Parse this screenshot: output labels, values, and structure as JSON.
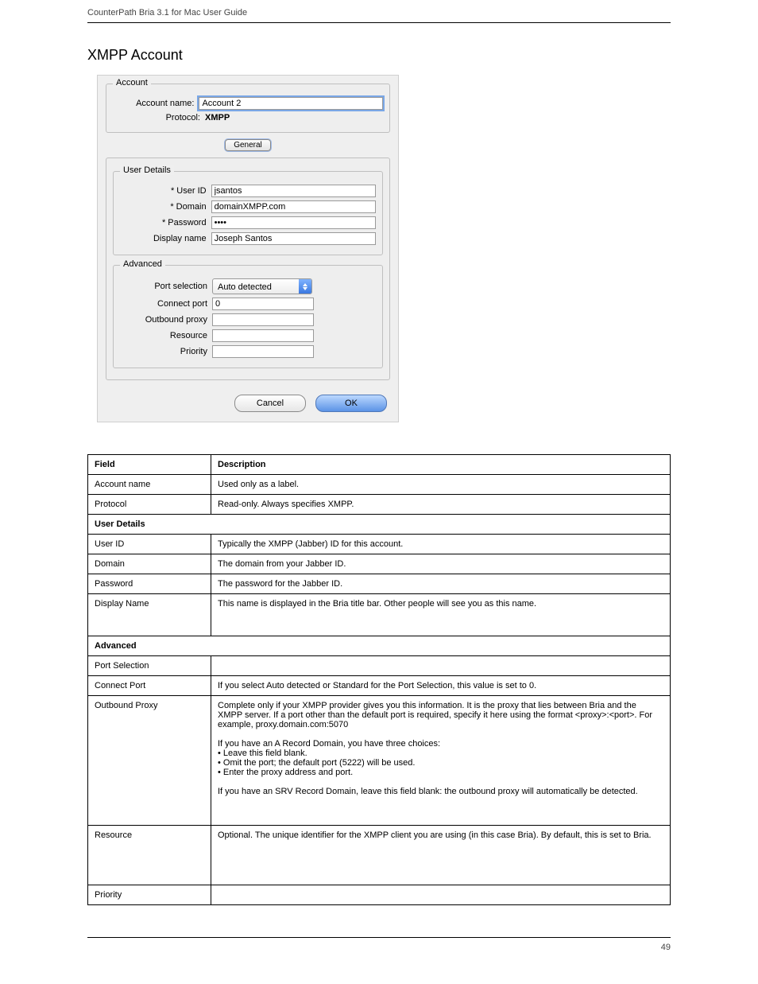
{
  "header": {
    "left": "CounterPath Bria 3.1 for Mac User Guide",
    "right": ""
  },
  "section_title": "XMPP Account",
  "dialog": {
    "account_legend": "Account",
    "account_name_label": "Account name:",
    "account_name_value": "Account 2",
    "protocol_label": "Protocol:",
    "protocol_value": "XMPP",
    "tab_general": "General",
    "user_details_legend": "User Details",
    "user_id_label": "* User ID",
    "user_id_value": "jsantos",
    "domain_label": "* Domain",
    "domain_value": "domainXMPP.com",
    "password_label": "* Password",
    "password_value": "••••",
    "display_name_label": "Display name",
    "display_name_value": "Joseph Santos",
    "advanced_legend": "Advanced",
    "port_selection_label": "Port selection",
    "port_selection_value": "Auto detected",
    "connect_port_label": "Connect port",
    "connect_port_value": "0",
    "outbound_proxy_label": "Outbound proxy",
    "outbound_proxy_value": "",
    "resource_label": "Resource",
    "resource_value": "",
    "priority_label": "Priority",
    "priority_value": "",
    "cancel_label": "Cancel",
    "ok_label": "OK"
  },
  "table": {
    "header_field": "Field",
    "header_desc": "Description",
    "rows": [
      {
        "field": "Account name",
        "desc": "Used only as a label.",
        "cls": ""
      },
      {
        "field": "Protocol",
        "desc": "Read-only. Always specifies XMPP.",
        "cls": ""
      },
      {
        "field": "User Details",
        "desc": "",
        "section": true
      },
      {
        "field": "User ID",
        "desc": "Typically the XMPP (Jabber) ID for this account.",
        "cls": ""
      },
      {
        "field": "Domain",
        "desc": "The domain from your Jabber ID.",
        "cls": ""
      },
      {
        "field": "Password",
        "desc": "The password for the Jabber ID.",
        "cls": ""
      },
      {
        "field": "Display Name",
        "desc": "This name is displayed in the Bria title bar. Other people will see you as this name.",
        "cls": "tall"
      },
      {
        "field": "Advanced",
        "desc": "",
        "section": true
      },
      {
        "field": "Port Selection",
        "desc": "",
        "cls": ""
      },
      {
        "field": "Connect Port",
        "desc": "If you select Auto detected or Standard for the Port Selection, this value is set to 0.",
        "cls": ""
      },
      {
        "field": "Outbound Proxy",
        "desc": "Complete only if your XMPP provider gives you this information. It is the proxy that lies between Bria and the XMPP server. If a port other than the default port is required, specify it here using the format <proxy>:<port>. For example, proxy.domain.com:5070\n\nIf you have an A Record Domain, you have three choices:\n• Leave this field blank.\n• Omit the port; the default port (5222) will be used.\n• Enter the proxy address and port.\n\nIf you have an SRV Record Domain, leave this field blank: the outbound proxy will automatically be detected.",
        "cls": "very-tall"
      },
      {
        "field": "Resource",
        "desc": "Optional. The unique identifier for the XMPP client you are using (in this case Bria). By default, this is set to Bria.",
        "cls": "med-tall"
      },
      {
        "field": "Priority",
        "desc": "",
        "cls": ""
      }
    ]
  },
  "footer": {
    "left": "",
    "right": "49"
  }
}
